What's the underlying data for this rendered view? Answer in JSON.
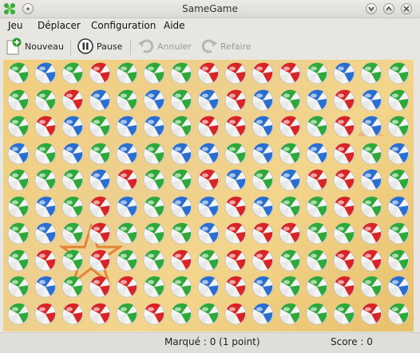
{
  "window": {
    "title": "SameGame"
  },
  "menu": [
    {
      "label": "Jeu",
      "key": "J"
    },
    {
      "label": "Déplacer",
      "key": "D"
    },
    {
      "label": "Configuration",
      "key": "C"
    },
    {
      "label": "Aide",
      "key": "A"
    }
  ],
  "toolbar": {
    "new_label": "Nouveau",
    "pause_label": "Pause",
    "undo_label": "Annuler",
    "redo_label": "Refaire"
  },
  "board": {
    "cols": 15,
    "rows": 10,
    "colors": {
      "R": "#d82424",
      "G": "#2fa83a",
      "B": "#2a6fd0"
    },
    "grid": [
      "GBGRGGGRRRRGBGG",
      "GGRBGBGBRBGBRBG",
      "GRBGBBGRRBRGRBG",
      "BGBGBGBBGBGBRGB",
      "GGGBRGGRBGBRRBG",
      "GBGRBGBBRBGGRGB",
      "GBGRGGGBRRRGGRG",
      "GRGRGGRGRRGGRRG",
      "GBGRRGGBRBGGRGB",
      "GRRRGRGGRBGGGRG"
    ]
  },
  "status": {
    "marked": "Marqué : 0 (1 point)",
    "score": "Score : 0"
  }
}
